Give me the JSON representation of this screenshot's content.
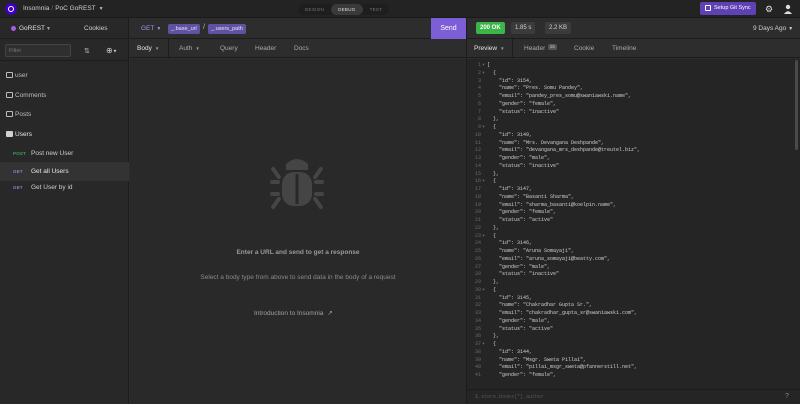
{
  "topbar": {
    "app_name": "Insomnia",
    "workspace": "PoC GoREST",
    "modes": [
      "DESIGN",
      "DEBUG",
      "TEST"
    ],
    "active_mode": "DEBUG",
    "git_sync_label": "Setup Git Sync"
  },
  "sidebar": {
    "environment": "GoREST",
    "cookies_label": "Cookies",
    "filter_placeholder": "Filter",
    "folders": [
      {
        "label": "user"
      },
      {
        "label": "Comments"
      },
      {
        "label": "Posts"
      },
      {
        "label": "Users"
      }
    ],
    "requests": [
      {
        "method": "POST",
        "label": "Post new User",
        "method_color": "#3aa657"
      },
      {
        "method": "GET",
        "label": "Get all Users",
        "method_color": "#8e7fd6"
      },
      {
        "method": "GET",
        "label": "Get User by id",
        "method_color": "#8e7fd6"
      }
    ]
  },
  "request": {
    "method": "GET",
    "url_tags": [
      "_.base_url",
      "_.users_path"
    ],
    "send_label": "Send",
    "tabs": [
      "Body",
      "Auth",
      "Query",
      "Header",
      "Docs"
    ],
    "empty_title": "Enter a URL and send to get a response",
    "empty_subtitle": "Select a body type from above to send data in the body of a request",
    "intro_link": "Introduction to Insomnia"
  },
  "response": {
    "status": "200 OK",
    "time": "1.85 s",
    "size": "2.2 KB",
    "received_ago": "9 Days Ago",
    "tabs": [
      "Preview",
      "Header",
      "Cookie",
      "Timeline"
    ],
    "header_count": "25",
    "filter_placeholder": "$.store.books[*].author",
    "colors": {
      "status_ok": "#3bb54a",
      "accent": "#7c5ed6"
    },
    "lines": [
      "[",
      "  {",
      "    \"id\": 3154,",
      "    \"name\": \"Pres. Somu Pandey\",",
      "    \"email\": \"pandey_pres_somu@swaniawski.name\",",
      "    \"gender\": \"female\",",
      "    \"status\": \"inactive\"",
      "  },",
      "  {",
      "    \"id\": 3149,",
      "    \"name\": \"Mrs. Devangana Deshpande\",",
      "    \"email\": \"devangana_mrs_deshpande@treutel.biz\",",
      "    \"gender\": \"male\",",
      "    \"status\": \"inactive\"",
      "  },",
      "  {",
      "    \"id\": 3147,",
      "    \"name\": \"Basanti Sharma\",",
      "    \"email\": \"sharma_basanti@koelpin.name\",",
      "    \"gender\": \"female\",",
      "    \"status\": \"active\"",
      "  },",
      "  {",
      "    \"id\": 3146,",
      "    \"name\": \"Aruna Somayaji\",",
      "    \"email\": \"aruna_somayaji@beatty.com\",",
      "    \"gender\": \"male\",",
      "    \"status\": \"inactive\"",
      "  },",
      "  {",
      "    \"id\": 3145,",
      "    \"name\": \"Chakradhar Gupta Sr.\",",
      "    \"email\": \"chakradhar_gupta_sr@swaniawski.com\",",
      "    \"gender\": \"male\",",
      "    \"status\": \"active\"",
      "  },",
      "  {",
      "    \"id\": 3144,",
      "    \"name\": \"Msgr. Sweta Pillai\",",
      "    \"email\": \"pillai_msgr_sweta@pfannerstill.net\",",
      "    \"gender\": \"female\","
    ]
  }
}
